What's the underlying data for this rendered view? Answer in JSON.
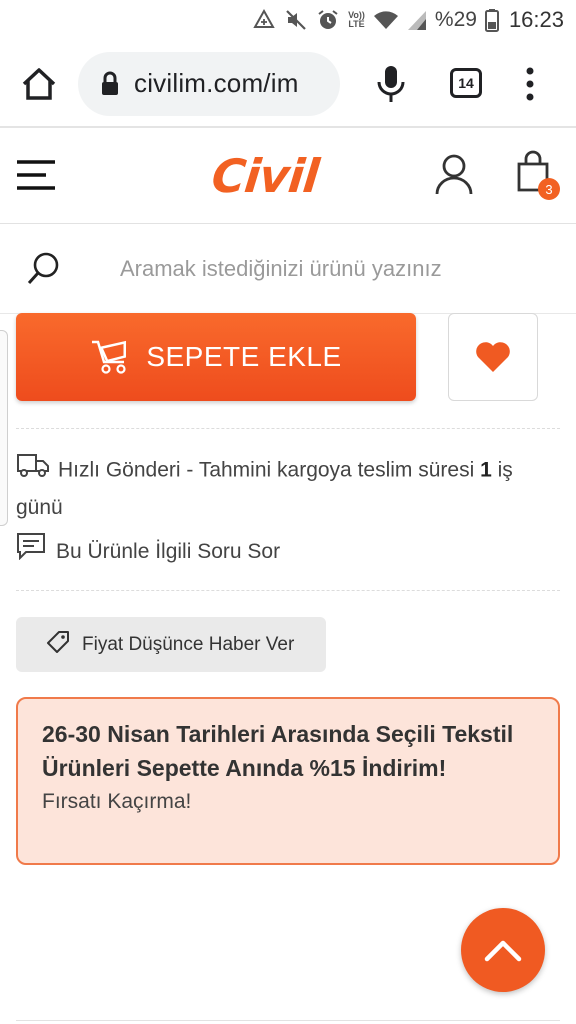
{
  "status_bar": {
    "battery_percent": "%29",
    "time": "16:23",
    "volte_label": "Vo)) LTE",
    "icons": [
      "data-saver-icon",
      "mute-icon",
      "alarm-icon",
      "volte-icon",
      "wifi-icon",
      "signal-icon",
      "battery-icon"
    ]
  },
  "browser": {
    "url": "civilim.com/im",
    "tab_count": "14",
    "icons": [
      "home-icon",
      "lock-icon",
      "mic-icon",
      "tabs-icon",
      "more-vert-icon"
    ]
  },
  "header": {
    "logo_text": "Civil",
    "cart_count": "3",
    "brand_color": "#f26122",
    "icons": [
      "hamburger-menu-icon",
      "user-icon",
      "shopping-bag-icon"
    ]
  },
  "search": {
    "placeholder": "Aramak istediğinizi ürünü yazınız",
    "value": ""
  },
  "product_actions": {
    "add_to_cart_label": "SEPETE EKLE",
    "button_color": "#f05a22",
    "favorite_icon": "heart-icon"
  },
  "shipping": {
    "text_before": "Hızlı Gönderi - Tahmini kargoya teslim süresi",
    "days": "1",
    "text_after": "iş günü",
    "icon": "truck-icon"
  },
  "question": {
    "label": "Bu Ürünle İlgili Soru Sor",
    "icon": "chat-icon"
  },
  "price_alert": {
    "label": "Fiyat Düşünce Haber Ver",
    "icon": "tag-icon"
  },
  "promo": {
    "title": "26-30 Nisan Tarihleri Arasında Seçili Tekstil Ürünleri Sepette Anında %15 İndirim!",
    "subtitle": "Fırsatı Kaçırma!"
  },
  "scroll_top": {
    "icon": "chevron-up-icon"
  }
}
